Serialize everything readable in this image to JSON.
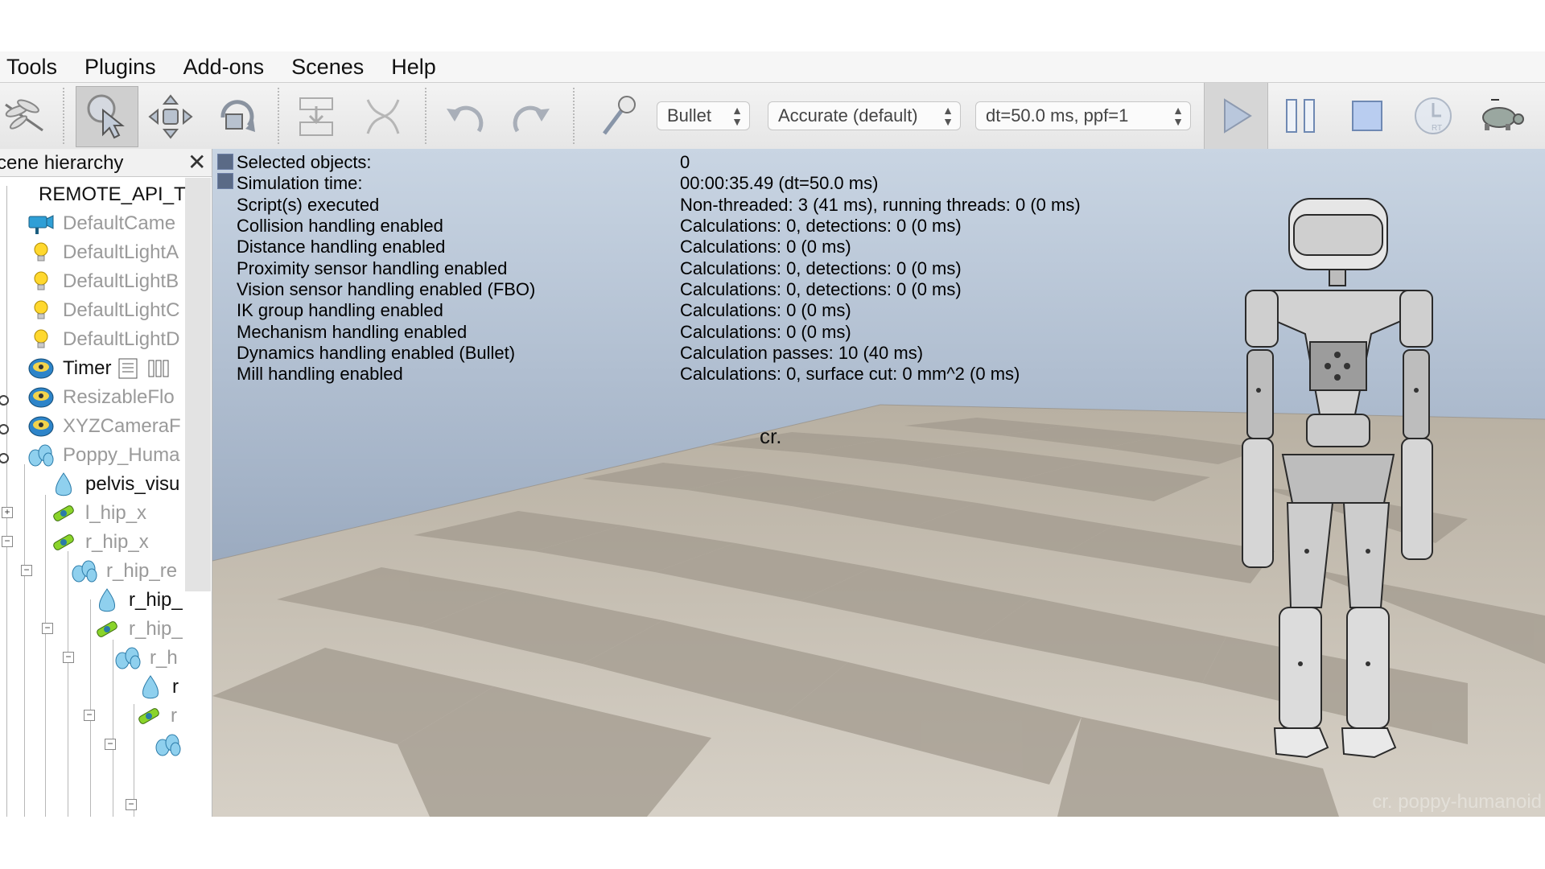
{
  "menu": [
    "Tools",
    "Plugins",
    "Add-ons",
    "Scenes",
    "Help"
  ],
  "toolbar": {
    "engine": "Bullet",
    "accuracy": "Accurate (default)",
    "timestep": "dt=50.0 ms, ppf=1"
  },
  "hierarchy": {
    "title": "cene hierarchy",
    "close": "✕",
    "root": "REMOTE_API_T",
    "items": [
      {
        "label": "DefaultCame",
        "icon": "camera-icon"
      },
      {
        "label": "DefaultLightA",
        "icon": "light-icon"
      },
      {
        "label": "DefaultLightB",
        "icon": "light-icon"
      },
      {
        "label": "DefaultLightC",
        "icon": "light-icon"
      },
      {
        "label": "DefaultLightD",
        "icon": "light-icon"
      },
      {
        "label": "Timer",
        "icon": "dummy-icon"
      },
      {
        "label": "ResizableFlo",
        "icon": "dummy-icon"
      },
      {
        "label": "XYZCameraF",
        "icon": "dummy-icon"
      },
      {
        "label": "Poppy_Huma",
        "icon": "shape-group-icon"
      },
      {
        "label": "pelvis_visu",
        "icon": "shape-icon"
      },
      {
        "label": "l_hip_x",
        "icon": "joint-icon"
      },
      {
        "label": "r_hip_x",
        "icon": "joint-icon"
      },
      {
        "label": "r_hip_re",
        "icon": "shape-group-icon"
      },
      {
        "label": "r_hip_",
        "icon": "shape-icon"
      },
      {
        "label": "r_hip_",
        "icon": "joint-icon"
      },
      {
        "label": "r_h",
        "icon": "shape-group-icon"
      },
      {
        "label": "r",
        "icon": "shape-icon"
      },
      {
        "label": "r",
        "icon": "joint-icon"
      }
    ]
  },
  "info": [
    {
      "label": "Selected objects:",
      "value": "0"
    },
    {
      "label": "Simulation time:",
      "value": "00:00:35.49 (dt=50.0 ms)"
    },
    {
      "label": "Script(s) executed",
      "value": "Non-threaded: 3 (41 ms), running threads: 0 (0 ms)"
    },
    {
      "label": "Collision handling enabled",
      "value": "Calculations: 0, detections: 0 (0 ms)"
    },
    {
      "label": "Distance handling enabled",
      "value": "Calculations: 0 (0 ms)"
    },
    {
      "label": "Proximity sensor handling enabled",
      "value": "Calculations: 0, detections: 0 (0 ms)"
    },
    {
      "label": "Vision sensor handling enabled (FBO)",
      "value": "Calculations: 0, detections: 0 (0 ms)"
    },
    {
      "label": "IK group handling enabled",
      "value": "Calculations: 0 (0 ms)"
    },
    {
      "label": "Mechanism handling enabled",
      "value": "Calculations: 0 (0 ms)"
    },
    {
      "label": "Dynamics handling enabled (Bullet)",
      "value": "Calculation passes: 10 (40 ms)"
    },
    {
      "label": "Mill handling enabled",
      "value": "Calculations: 0, surface cut: 0 mm^2 (0 ms)"
    }
  ],
  "scene": {
    "floating_text": "cr.",
    "watermark": "cr. poppy-humanoid"
  }
}
